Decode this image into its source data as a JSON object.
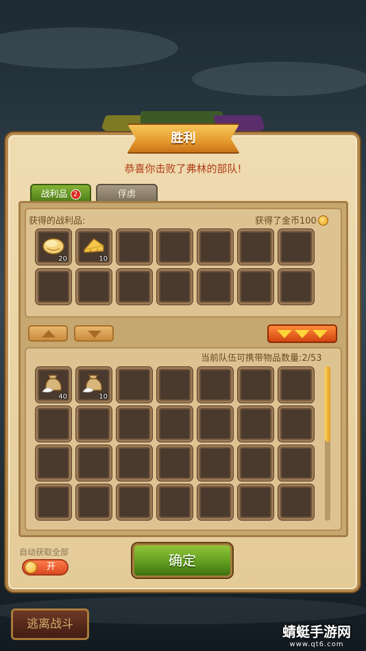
{
  "header": {
    "title": "胜利",
    "subtitle": "恭喜你击败了弗林的部队!"
  },
  "tabs": [
    {
      "label": "战利品",
      "badge": "2",
      "active": true
    },
    {
      "label": "俘虏",
      "active": false
    }
  ],
  "loot": {
    "label": "获得的战利品:",
    "gold_text": "获得了金币100",
    "items": [
      {
        "icon": "bread-icon",
        "qty": "20"
      },
      {
        "icon": "cheese-icon",
        "qty": "10"
      }
    ]
  },
  "inventory": {
    "capacity_text": "当前队伍可携带物品数量:2/53",
    "items": [
      {
        "icon": "flour-sack-icon",
        "qty": "40"
      },
      {
        "icon": "flour-sack-icon",
        "qty": "10"
      }
    ]
  },
  "footer": {
    "auto_label": "自动获取全部",
    "toggle_label": "开",
    "confirm_label": "确定",
    "flee_label": "逃离战斗"
  },
  "watermark": {
    "title": "蜻蜓手游网",
    "url": "www.qt6.com"
  }
}
